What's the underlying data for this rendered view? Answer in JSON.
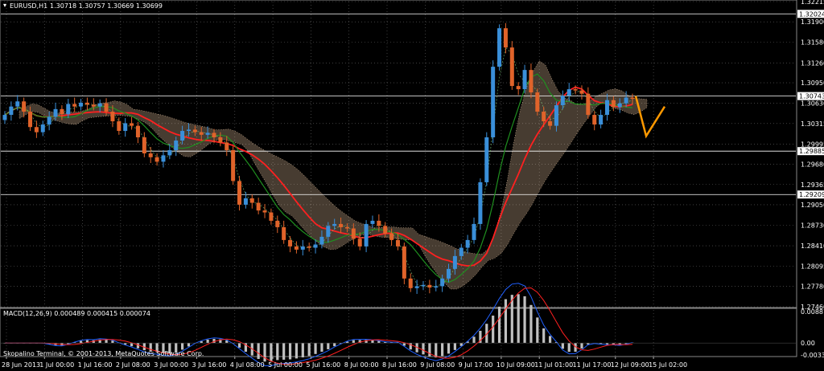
{
  "header": {
    "symbol_label": "EURUSD,H1",
    "ohlc": "1.30718 1.30757 1.30669 1.30699"
  },
  "macd_label": "MACD(12,26,9) 0.000489 0.000415 0.000074",
  "copyright": "Skopalino Terminal, © 2001-2013, MetaQuotes Software Corp.",
  "colors": {
    "background": "#000000",
    "grid": "#666666",
    "bull_candle": "#3a8fd9",
    "bear_candle": "#e0632a",
    "ma_slow": "#ff2020",
    "ma_fast": "#1f8f1f",
    "ma_fast_light": "#7fd07f",
    "cloud": "#ffd8b0",
    "forecast": "#ff9900",
    "macd_hist": "#c0c0c0",
    "macd_line": "#2060ff",
    "macd_signal": "#ff2020",
    "level_line": "#ffffff"
  },
  "chart_data": [
    {
      "type": "candlestick",
      "symbol": "EURUSD",
      "timeframe": "H1",
      "ylim": [
        1.2746,
        1.32215
      ],
      "yticks": [
        1.32215,
        1.319,
        1.3158,
        1.3126,
        1.3095,
        1.3063,
        1.30315,
        1.29995,
        1.2968,
        1.29365,
        1.2905,
        1.2873,
        1.2841,
        1.28095,
        1.2778,
        1.2746
      ],
      "ytick_labels": [
        "1.32215",
        "1.31900",
        "1.31580",
        "1.31260",
        "1.30950",
        "1.30630",
        "1.30315",
        "1.29995",
        "1.29680",
        "1.29365",
        "1.29050",
        "1.28730",
        "1.28410",
        "1.28095",
        "1.27780",
        "1.27460"
      ],
      "xtick_labels": [
        "28 Jun 2013",
        "1 Jul 00:00",
        "1 Jul 16:00",
        "2 Jul 08:00",
        "3 Jul 00:00",
        "3 Jul 16:00",
        "4 Jul 08:00",
        "5 Jul 00:00",
        "5 Jul 16:00",
        "8 Jul 00:00",
        "8 Jul 16:00",
        "9 Jul 08:00",
        "9 Jul 17:00",
        "10 Jul 09:00",
        "11 Jul 01:00",
        "11 Jul 17:00",
        "12 Jul 09:00",
        "15 Jul 02:00"
      ],
      "price_levels": [
        {
          "value": 1.32024,
          "label": "1.32024"
        },
        {
          "value": 1.30743,
          "label": "1.30743"
        },
        {
          "value": 1.29885,
          "label": "1.29885"
        },
        {
          "value": 1.29209,
          "label": "1.29209"
        }
      ],
      "close_series": [
        1.3045,
        1.3058,
        1.3066,
        1.305,
        1.3026,
        1.3018,
        1.303,
        1.3042,
        1.3054,
        1.3046,
        1.3062,
        1.3058,
        1.3064,
        1.3061,
        1.3058,
        1.3063,
        1.305,
        1.3035,
        1.302,
        1.3032,
        1.3028,
        1.301,
        1.2985,
        1.2979,
        1.2972,
        1.2982,
        1.299,
        1.3005,
        1.302,
        1.3022,
        1.3018,
        1.3014,
        1.3017,
        1.301,
        1.3002,
        1.299,
        1.2942,
        1.2905,
        1.2915,
        1.2908,
        1.2896,
        1.2893,
        1.288,
        1.287,
        1.285,
        1.284,
        1.2835,
        1.284,
        1.2838,
        1.2843,
        1.2855,
        1.2872,
        1.2875,
        1.287,
        1.2868,
        1.2852,
        1.284,
        1.2875,
        1.288,
        1.2872,
        1.286,
        1.285,
        1.284,
        1.279,
        1.2775,
        1.2778,
        1.278,
        1.2776,
        1.2778,
        1.279,
        1.2805,
        1.2825,
        1.2838,
        1.285,
        1.2875,
        1.294,
        1.301,
        1.312,
        1.318,
        1.315,
        1.309,
        1.3085,
        1.3115,
        1.308,
        1.305,
        1.3035,
        1.3028,
        1.306,
        1.3075,
        1.3085,
        1.3083,
        1.3078,
        1.3045,
        1.303,
        1.3045,
        1.3068,
        1.3057,
        1.3063,
        1.3072,
        1.307
      ],
      "forecast_line": [
        1.30743,
        1.3012,
        1.3058
      ],
      "notes": "Close values are approximate readings of the candlestick path; shown with moving averages (red, green) and a dotted cloud band."
    },
    {
      "type": "histogram",
      "name": "MACD(12,26,9)",
      "values_shown": [
        0.000489,
        0.000415,
        7.4e-05
      ],
      "ylim": [
        -0.003361,
        0.008879
      ],
      "ytick_labels": [
        "0.008879",
        "0.00",
        "-0.003361"
      ]
    }
  ]
}
